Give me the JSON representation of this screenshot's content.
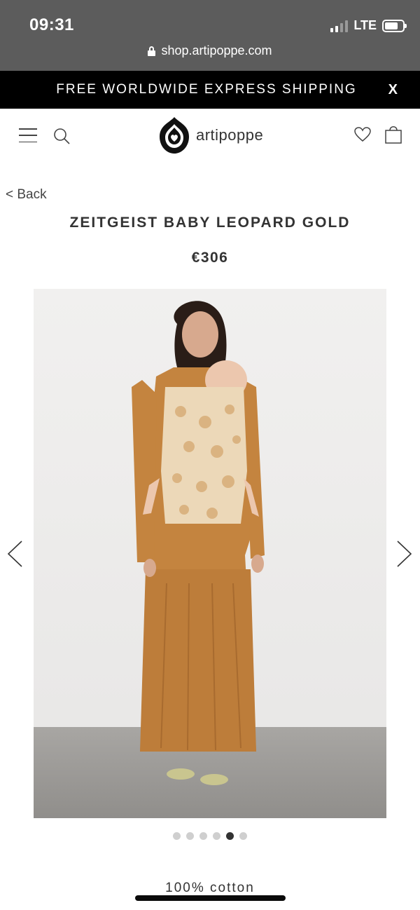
{
  "status_bar": {
    "time": "09:31",
    "network": "LTE"
  },
  "browser": {
    "url": "shop.artipoppe.com"
  },
  "banner": {
    "text": "FREE WORLDWIDE EXPRESS SHIPPING",
    "close_label": "X"
  },
  "header": {
    "logo_text": "artipoppe",
    "icons": [
      "menu-icon",
      "search-icon",
      "logo-icon",
      "heart-icon",
      "shopping-bag-icon"
    ]
  },
  "product": {
    "back_label": "< Back",
    "title": "ZEITGEIST BABY LEOPARD GOLD",
    "price": "€306",
    "image_count": 6,
    "active_image": 5,
    "material": "100% cotton"
  },
  "colors": {
    "banner_bg": "#000000",
    "status_bg": "#5c5c5c",
    "dress": "#c4843f",
    "carrier": "#ecd8b8"
  }
}
